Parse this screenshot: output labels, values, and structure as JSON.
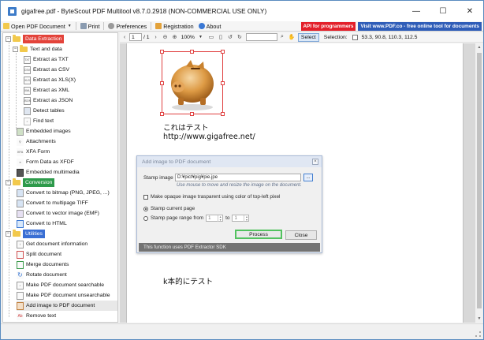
{
  "window": {
    "title": "gigafree.pdf - ByteScout PDF Multitool v8.7.0.2918 (NON-COMMERCIAL USE ONLY)",
    "controls": {
      "minimize": "—",
      "maximize": "☐",
      "close": "✕"
    }
  },
  "menubar": {
    "open": "Open PDF Document",
    "print": "Print",
    "preferences": "Preferences",
    "registration": "Registration",
    "about": "About",
    "api": "API for programmers",
    "visit": "Visit www.PDF.co - free online tool for documents",
    "colors": {
      "api": "#e3202a",
      "visit": "#2f5db8"
    }
  },
  "sidebar": {
    "categories": {
      "extraction": "Data Extraction",
      "conversion": "Conversion",
      "utilities": "Utilities"
    },
    "text_and_data": "Text and data",
    "extract_items": [
      {
        "badge": "TXT",
        "label": "Extract as TXT"
      },
      {
        "badge": "CSV",
        "label": "Extract as CSV"
      },
      {
        "badge": "XLS",
        "label": "Extract as XLS(X)"
      },
      {
        "badge": "XML",
        "label": "Extract as XML"
      },
      {
        "badge": "JSON",
        "label": "Extract as JSON"
      },
      {
        "badge": "",
        "label": "Detect tables"
      },
      {
        "badge": "",
        "label": "Find text"
      }
    ],
    "extraction_items": [
      "Embedded images",
      "Attachments",
      "XFA Form",
      "Form Data as XFDF",
      "Embedded multimedia"
    ],
    "conversion_items": [
      "Convert to bitmap (PNG, JPEG, ...)",
      "Convert to multipage TIFF",
      "Convert to vector image (EMF)",
      "Convert to HTML"
    ],
    "utility_items": [
      "Get document information",
      "Split document",
      "Merge documents",
      "Rotate document",
      "Make PDF document searchable",
      "Make PDF document unsearchable",
      "Add image to PDF document",
      "Remove text"
    ],
    "selected_item": "Add image to PDF document",
    "colors": {
      "extraction": "#e3433a",
      "conversion": "#2e9a4b",
      "utilities": "#3a6fd4"
    }
  },
  "doc_toolbar": {
    "page_value": "1",
    "page_total": "/ 1",
    "zoom": "100%",
    "search_value": "",
    "select_label": "Select",
    "selection_label": "Selection:",
    "selection_value": "53.3, 90.8, 110.3, 112.5"
  },
  "document": {
    "line1": "これはテスト",
    "line2": "http://www.gigafree.net/",
    "line3": "k本的にテスト"
  },
  "dialog": {
    "title": "Add image to PDF document",
    "stamp_image_label": "Stamp image",
    "stamp_image_value": "D:¥pict¥pig¥pie.jpe",
    "browse": "...",
    "hint": "Use mouse to move and resize the image on the document.",
    "transparent_label": "Make opaque image trasparent using color of top-left pixel",
    "current_page_label": "Stamp current page",
    "range_label": "Stamp page range from",
    "range_from": "1",
    "range_to_label": "to",
    "range_to": "1",
    "process": "Process",
    "close": "Close",
    "footer": "This function uses PDF Extractor SDK"
  }
}
